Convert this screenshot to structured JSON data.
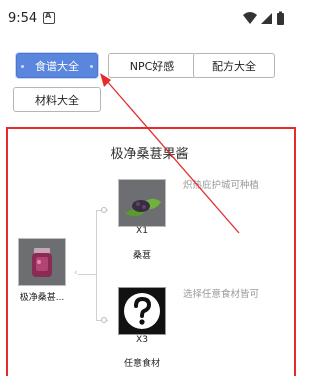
{
  "status_bar": {
    "time": "9:54"
  },
  "tabs": [
    {
      "label": "食谱大全",
      "active": true
    },
    {
      "label": "NPC好感",
      "active": false
    },
    {
      "label": "配方大全",
      "active": false
    },
    {
      "label": "材料大全",
      "active": false
    }
  ],
  "recipe": {
    "title": "极净桑葚果酱",
    "result": {
      "name": "极净桑甚..."
    },
    "ingredients": [
      {
        "name": "桑葚",
        "quantity": "X1",
        "note": "炽热庇护城可种植"
      },
      {
        "name": "任意食材",
        "quantity": "X3",
        "note": "选择任意食材皆可"
      }
    ]
  },
  "colors": {
    "accent": "#5b86dd",
    "annotation": "#e52b2b"
  }
}
